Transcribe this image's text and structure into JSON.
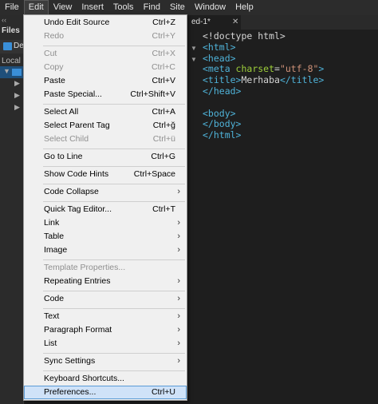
{
  "menubar": {
    "items": [
      "File",
      "Edit",
      "View",
      "Insert",
      "Tools",
      "Find",
      "Site",
      "Window",
      "Help"
    ]
  },
  "left_panel": {
    "collapse": "‹‹",
    "files_label": "Files",
    "site_label": "De",
    "local_label": "Local"
  },
  "editor": {
    "tab_label": "ed-1*",
    "tab_close": "✕",
    "code": {
      "doctype": "<!doctype html>",
      "html_open": "<html>",
      "head_open": "<head>",
      "meta_open": "<meta ",
      "meta_attr": "charset",
      "meta_eq": "=",
      "meta_val": "\"utf-8\"",
      "meta_close": ">",
      "title_open": "<title>",
      "title_text": "Merhaba",
      "title_close": "</title>",
      "head_close": "</head>",
      "body_open": "<body>",
      "body_close": "</body>",
      "html_close": "</html>"
    }
  },
  "edit_menu": {
    "undo": {
      "label": "Undo Edit Source",
      "shortcut": "Ctrl+Z"
    },
    "redo": {
      "label": "Redo",
      "shortcut": "Ctrl+Y"
    },
    "cut": {
      "label": "Cut",
      "shortcut": "Ctrl+X"
    },
    "copy": {
      "label": "Copy",
      "shortcut": "Ctrl+C"
    },
    "paste": {
      "label": "Paste",
      "shortcut": "Ctrl+V"
    },
    "paste_special": {
      "label": "Paste Special...",
      "shortcut": "Ctrl+Shift+V"
    },
    "select_all": {
      "label": "Select All",
      "shortcut": "Ctrl+A"
    },
    "select_parent_tag": {
      "label": "Select Parent Tag",
      "shortcut": "Ctrl+ğ"
    },
    "select_child": {
      "label": "Select Child",
      "shortcut": "Ctrl+ü"
    },
    "go_to_line": {
      "label": "Go to Line",
      "shortcut": "Ctrl+G"
    },
    "show_code_hints": {
      "label": "Show Code Hints",
      "shortcut": "Ctrl+Space"
    },
    "code_collapse": {
      "label": "Code Collapse"
    },
    "quick_tag_editor": {
      "label": "Quick Tag Editor...",
      "shortcut": "Ctrl+T"
    },
    "link": {
      "label": "Link"
    },
    "table": {
      "label": "Table"
    },
    "image": {
      "label": "Image"
    },
    "template_properties": {
      "label": "Template Properties..."
    },
    "repeating_entries": {
      "label": "Repeating Entries"
    },
    "code": {
      "label": "Code"
    },
    "text": {
      "label": "Text"
    },
    "paragraph_format": {
      "label": "Paragraph Format"
    },
    "list": {
      "label": "List"
    },
    "sync_settings": {
      "label": "Sync Settings"
    },
    "keyboard_shortcuts": {
      "label": "Keyboard Shortcuts..."
    },
    "preferences": {
      "label": "Preferences...",
      "shortcut": "Ctrl+U"
    },
    "submenu_glyph": "›"
  }
}
